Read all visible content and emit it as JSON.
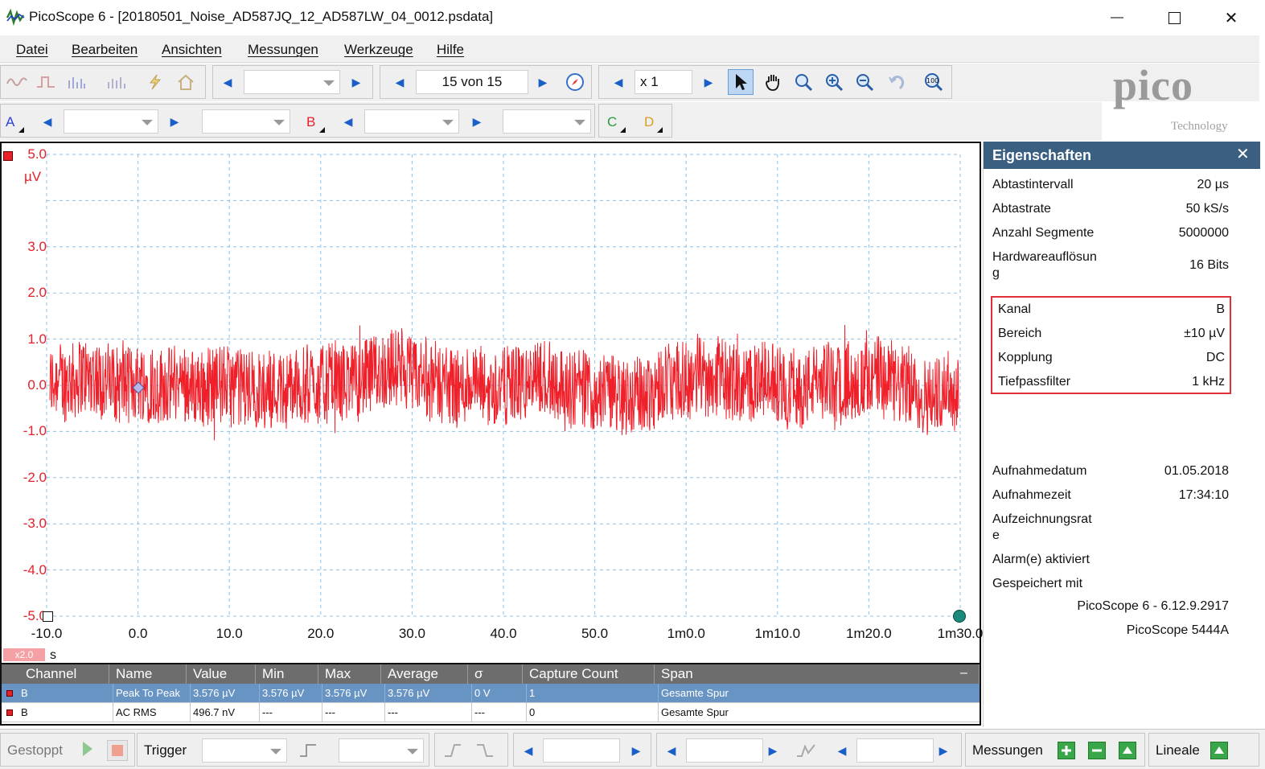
{
  "window": {
    "title": "PicoScope 6 - [20180501_Noise_AD587JQ_12_AD587LW_04_0012.psdata]",
    "minimize": "—",
    "maximize": "☐",
    "close": "✕"
  },
  "menu": [
    "Datei",
    "Bearbeiten",
    "Ansichten",
    "Messungen",
    "Werkzeuge",
    "Hilfe"
  ],
  "toolbar": {
    "buffer_position": "15 von 15",
    "zoom_factor": "x 1",
    "brand_name": "pico",
    "brand_sub": "Technology"
  },
  "channels": {
    "a_label": "A",
    "b_label": "B",
    "c_label": "C",
    "d_label": "D"
  },
  "scope": {
    "y_unit": "µV",
    "y_ticks": [
      "5.0",
      "3.0",
      "2.0",
      "1.0",
      "0.0",
      "-1.0",
      "-2.0",
      "-3.0",
      "-4.0",
      "-5.0"
    ],
    "x_ticks": [
      "-10.0",
      "0.0",
      "10.0",
      "20.0",
      "30.0",
      "40.0",
      "50.0",
      "1m0.0",
      "1m10.0",
      "1m20.0",
      "1m30.0"
    ],
    "x_unit": "s",
    "x_zoom": "x2.0",
    "trace_color": "#f0202a"
  },
  "measurements": {
    "headers": [
      "Channel",
      "Name",
      "Value",
      "Min",
      "Max",
      "Average",
      "σ",
      "Capture Count",
      "Span"
    ],
    "rows": [
      [
        "B",
        "Peak To Peak",
        "3.576 µV",
        "3.576 µV",
        "3.576 µV",
        "3.576 µV",
        "0 V",
        "1",
        "Gesamte Spur"
      ],
      [
        "B",
        "AC RMS",
        "496.7 nV",
        "---",
        "---",
        "---",
        "---",
        "0",
        "Gesamte Spur"
      ]
    ],
    "collapse": "–"
  },
  "properties": {
    "title": "Eigenschaften",
    "close": "✕",
    "rows": [
      {
        "label": "Abtastintervall",
        "value": "20 µs"
      },
      {
        "label": "Abtastrate",
        "value": "50 kS/s"
      },
      {
        "label": "Anzahl Segmente",
        "value": "5000000"
      },
      {
        "label": "Hardwareauflösun",
        "label2": "g",
        "value": "16 Bits"
      }
    ],
    "channel_rows": [
      {
        "label": "Kanal",
        "value": "B"
      },
      {
        "label": "Bereich",
        "value": "±10 µV"
      },
      {
        "label": "Kopplung",
        "value": "DC"
      },
      {
        "label": "Tiefpassfilter",
        "value": "1 kHz"
      }
    ],
    "capture_rows": [
      {
        "label": "Aufnahmedatum",
        "value": "01.05.2018"
      },
      {
        "label": "Aufnahmezeit",
        "value": "17:34:10"
      },
      {
        "label": "Aufzeichnungsrat",
        "label2": "e",
        "value": ""
      },
      {
        "label": "Alarm(e) aktiviert",
        "value": ""
      },
      {
        "label": "Gespeichert mit",
        "value": ""
      }
    ],
    "software": "PicoScope 6 - 6.12.9.2917",
    "device": "PicoScope 5444A"
  },
  "bottom": {
    "status": "Gestoppt",
    "trigger": "Trigger",
    "measurements": "Messungen",
    "rulers": "Lineale"
  }
}
